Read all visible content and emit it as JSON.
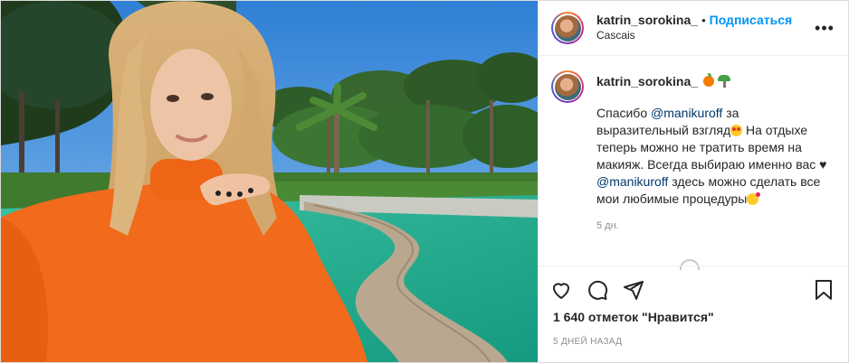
{
  "post": {
    "username": "katrin_sorokina_",
    "separator": "•",
    "follow_label": "Подписаться",
    "location": "Cascais",
    "more_icon": "more-horizontal-icon"
  },
  "caption": {
    "username": "katrin_sorokina_",
    "name_emojis": [
      "orange-emoji",
      "palm-tree-emoji"
    ],
    "text_1": "Спасибо ",
    "mention_1": "@manikuroff",
    "text_2": " за выразительный взгляд",
    "text_3": " На отдыхе теперь можно не тратить время на макияж. Всегда выбираю именно вас ",
    "heart_glyph": "♥",
    "mention_2": "@manikuroff",
    "text_4": " здесь можно сделать все мои любимые процедуры",
    "time": "5 дн."
  },
  "actions": {
    "like_icon": "heart-icon",
    "comment_icon": "comment-icon",
    "share_icon": "share-icon",
    "save_icon": "bookmark-icon"
  },
  "likes": "1 640 отметок \"Нравится\"",
  "date": "5 ДНЕЙ НАЗАД",
  "colors": {
    "accent": "#0095f6",
    "mention": "#00376b",
    "muted": "#8e8e8e",
    "sweater": "#f26a1b",
    "pool": "#2fb39a",
    "sky": "#3b8fe0"
  }
}
